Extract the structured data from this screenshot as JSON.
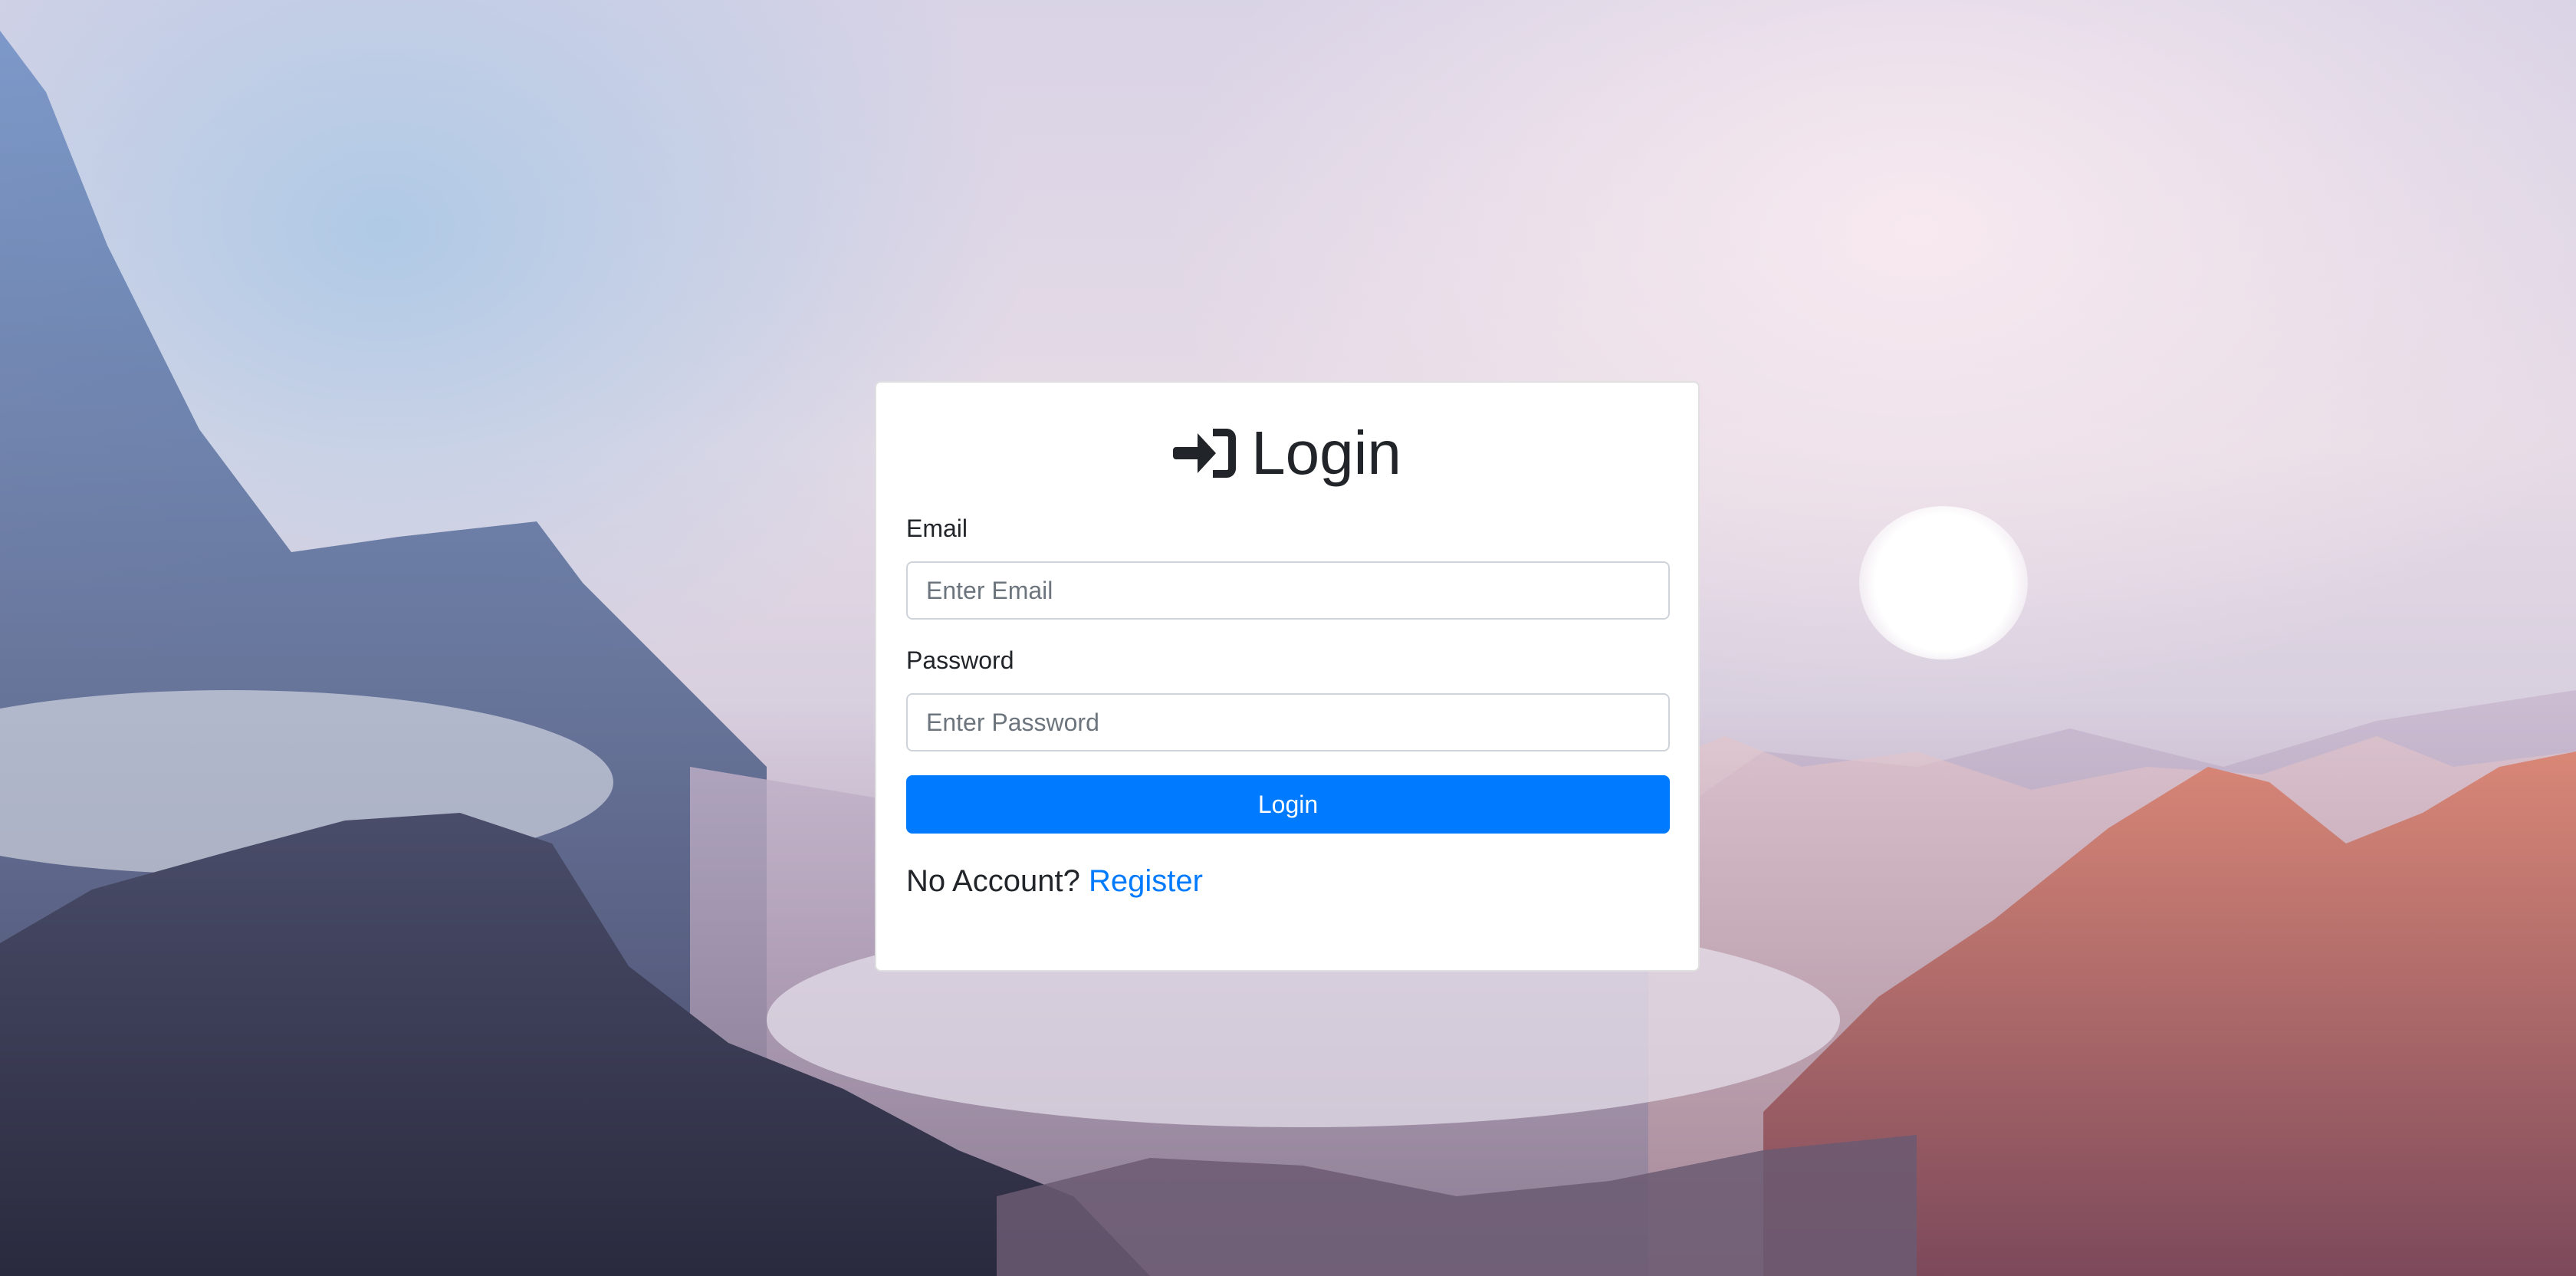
{
  "login": {
    "title": "Login",
    "title_icon": "sign-in-icon",
    "email_label": "Email",
    "email_placeholder": "Enter Email",
    "email_value": "",
    "password_label": "Password",
    "password_placeholder": "Enter Password",
    "password_value": "",
    "submit_label": "Login",
    "no_account_text": "No Account?",
    "register_link": "Register"
  },
  "colors": {
    "primary": "#007bff",
    "text": "#212529",
    "card_background": "#ffffff"
  }
}
